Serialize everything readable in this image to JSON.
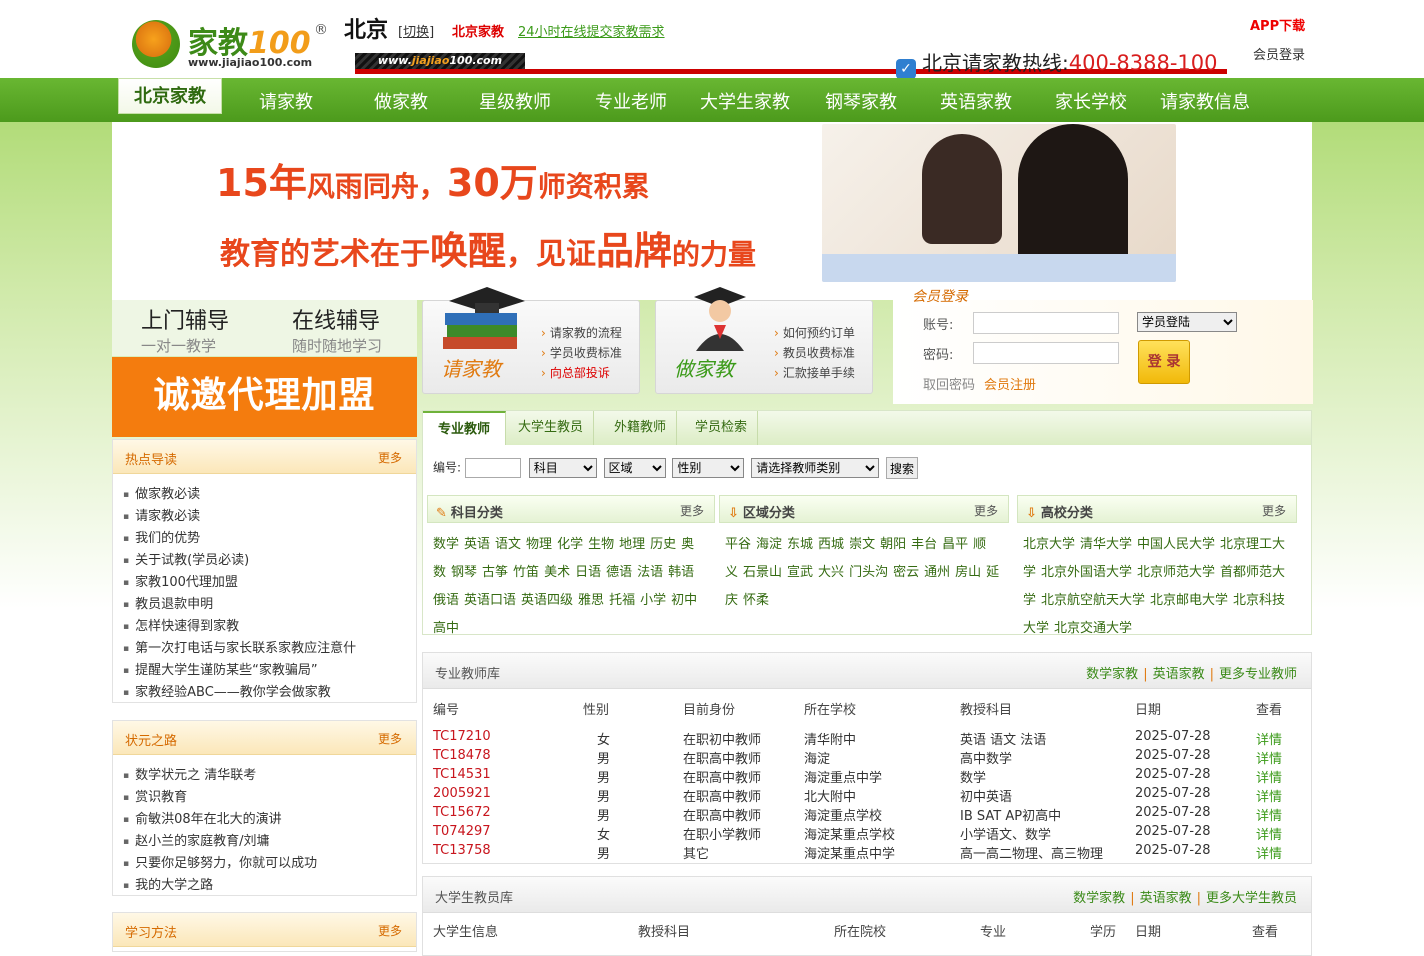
{
  "header": {
    "logo": {
      "brand_cn": "家教",
      "brand_num": "100",
      "reg": "®",
      "url": "www.jiajiao100.com"
    },
    "city": "北京",
    "switch_label": "[切换]",
    "beijing_link": "北京家教",
    "online_link": "24小时在线提交家教需求",
    "url_bar": {
      "pre": "www.",
      "mid": "jiajiao",
      "post": "100.com"
    },
    "hotline_label": "北京请家教热线:",
    "hotline_number": "400-8388-100",
    "app_download": "APP下载",
    "member_login": "会员登录"
  },
  "nav": {
    "active": "北京家教",
    "items": [
      "请家教",
      "做家教",
      "星级教师",
      "专业老师",
      "大学生家教",
      "钢琴家教",
      "英语家教",
      "家长学校",
      "请家教信息"
    ]
  },
  "banner": {
    "line1": {
      "a": "15年",
      "b": "风雨同舟，",
      "c": "30万",
      "d": "师资积累"
    },
    "line2": {
      "a": "教育的艺术在于",
      "b": "唤醒",
      "c": "，见证",
      "d": "品牌",
      "e": "的力量"
    }
  },
  "services": {
    "home_tutor": {
      "title": "上门辅导",
      "sub": "一对一教学"
    },
    "online_tutor": {
      "title": "在线辅导",
      "sub": "随时随地学习"
    },
    "agent": "诚邀代理加盟"
  },
  "hire_box": {
    "title": "请家教",
    "links": [
      "请家教的流程",
      "学员收费标准",
      "向总部投诉"
    ]
  },
  "work_box": {
    "title": "做家教",
    "links": [
      "如何预约订单",
      "教员收费标准",
      "汇款接单手续"
    ]
  },
  "login": {
    "title": "会员登录",
    "account_label": "账号:",
    "password_label": "密码:",
    "role_selected": "学员登陆",
    "submit": "登 录",
    "forgot": "取回密码",
    "register": "会员注册"
  },
  "hot_reads": {
    "title": "热点导读",
    "more": "更多",
    "items": [
      "做家教必读",
      "请家教必读",
      "我们的优势",
      "关于试教(学员必读)",
      "家教100代理加盟",
      "教员退款申明",
      "怎样快速得到家教",
      "第一次打电话与家长联系家教应注意什",
      "提醒大学生谨防某些“家教骗局”",
      "家教经验ABC——教你学会做家教"
    ]
  },
  "champion": {
    "title": "状元之路",
    "more": "更多",
    "items": [
      "数学状元之 清华联考",
      "赏识教育",
      "俞敏洪08年在北大的演讲",
      "赵小兰的家庭教育/刘墉",
      "只要你足够努力，你就可以成功",
      "我的大学之路"
    ]
  },
  "study_method": {
    "title": "学习方法",
    "more": "更多"
  },
  "teacher_tabs": [
    "专业教师",
    "大学生教员",
    "外籍教师",
    "学员检索"
  ],
  "search": {
    "id_label": "编号:",
    "subject": "科目",
    "area": "区域",
    "gender": "性别",
    "type": "请选择教师类别",
    "button": "搜索"
  },
  "subject_cat": {
    "title": "科目分类",
    "more": "更多",
    "items": [
      "数学",
      "英语",
      "语文",
      "物理",
      "化学",
      "生物",
      "地理",
      "历史",
      "奥数",
      "钢琴",
      "古筝",
      "竹笛",
      "美术",
      "日语",
      "德语",
      "法语",
      "韩语",
      "俄语",
      "英语口语",
      "英语四级",
      "雅思",
      "托福",
      "小学",
      "初中",
      "高中"
    ]
  },
  "area_cat": {
    "title": "区域分类",
    "more": "更多",
    "items": [
      "平谷",
      "海淀",
      "东城",
      "西城",
      "崇文",
      "朝阳",
      "丰台",
      "昌平",
      "顺义",
      "石景山",
      "宣武",
      "大兴",
      "门头沟",
      "密云",
      "通州",
      "房山",
      "延庆",
      "怀柔"
    ]
  },
  "school_cat": {
    "title": "高校分类",
    "more": "更多",
    "items": [
      "北京大学",
      "清华大学",
      "中国人民大学",
      "北京理工大学",
      "北京外国语大学",
      "北京师范大学",
      "首都师范大学",
      "北京航空航天大学",
      "北京邮电大学",
      "北京科技大学",
      "北京交通大学"
    ]
  },
  "pro_table": {
    "title": "专业教师库",
    "links": [
      "数学家教",
      "英语家教",
      "更多专业教师"
    ],
    "headers": [
      "编号",
      "性别",
      "目前身份",
      "所在学校",
      "教授科目",
      "日期",
      "查看"
    ],
    "rows": [
      [
        "TC17210",
        "女",
        "在职初中教师",
        "清华附中",
        "英语 语文 法语",
        "2025-07-28",
        "详情"
      ],
      [
        "TC18478",
        "男",
        "在职高中教师",
        "海淀",
        "高中数学",
        "2025-07-28",
        "详情"
      ],
      [
        "TC14531",
        "男",
        "在职高中教师",
        "海淀重点中学",
        "数学",
        "2025-07-28",
        "详情"
      ],
      [
        "2005921",
        "男",
        "在职高中教师",
        "北大附中",
        "初中英语",
        "2025-07-28",
        "详情"
      ],
      [
        "TC15672",
        "男",
        "在职高中教师",
        "海淀重点学校",
        "IB SAT AP初高中",
        "2025-07-28",
        "详情"
      ],
      [
        "T074297",
        "女",
        "在职小学教师",
        "海淀某重点学校",
        "小学语文、数学",
        "2025-07-28",
        "详情"
      ],
      [
        "TC13758",
        "男",
        "其它",
        "海淀某重点中学",
        "高一高二物理、高三物理",
        "2025-07-28",
        "详情"
      ]
    ]
  },
  "stu_table": {
    "title": "大学生教员库",
    "links": [
      "数学家教",
      "英语家教",
      "更多大学生教员"
    ],
    "headers": [
      "大学生信息",
      "教授科目",
      "所在院校",
      "专业",
      "学历",
      "日期",
      "查看"
    ]
  }
}
